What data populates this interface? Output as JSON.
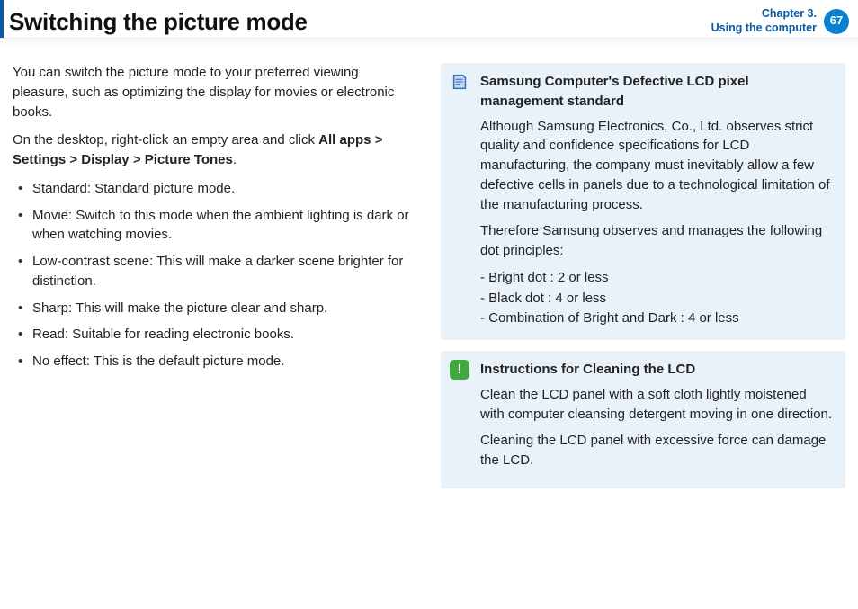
{
  "header": {
    "title": "Switching the picture mode",
    "chapter_line1": "Chapter 3.",
    "chapter_line2": "Using the computer",
    "page_number": "67"
  },
  "left": {
    "intro": "You can switch the picture mode to your preferred viewing pleasure, such as optimizing the display for movies or electronic books.",
    "nav_prefix": "On the desktop, right-click an empty area and click ",
    "nav_bold_1": "All apps",
    "nav_caret_1": " > ",
    "nav_bold_2": "Settings",
    "nav_caret_2": " > ",
    "nav_bold_3": "Display",
    "nav_caret_3": " > ",
    "nav_bold_4": "Picture Tones",
    "nav_suffix": ".",
    "bullets": [
      "Standard: Standard picture mode.",
      "Movie: Switch to this mode when the ambient lighting is dark or when watching movies.",
      "Low-contrast scene: This will make a darker scene brighter for distinction.",
      "Sharp: This will make the picture clear and sharp.",
      "Read: Suitable for reading electronic books.",
      "No effect: This is the default picture mode."
    ]
  },
  "panel1": {
    "title": "Samsung Computer's Defective LCD pixel management standard",
    "para1": "Although Samsung Electronics, Co., Ltd. observes strict quality and confidence specifications for LCD manufacturing, the company must inevitably allow a few defective cells in panels due to a technological limitation of the manufacturing process.",
    "para2": "Therefore Samsung observes and manages the following dot principles:",
    "dash1": "- Bright dot : 2 or less",
    "dash2": "- Black dot  : 4 or less",
    "dash3": "- Combination of Bright and Dark : 4 or less"
  },
  "panel2": {
    "title": "Instructions for Cleaning the LCD",
    "para1": "Clean the LCD panel with a soft cloth lightly moistened with computer cleansing detergent moving in one direction.",
    "para2": "Cleaning the LCD panel with excessive force can damage the LCD."
  }
}
